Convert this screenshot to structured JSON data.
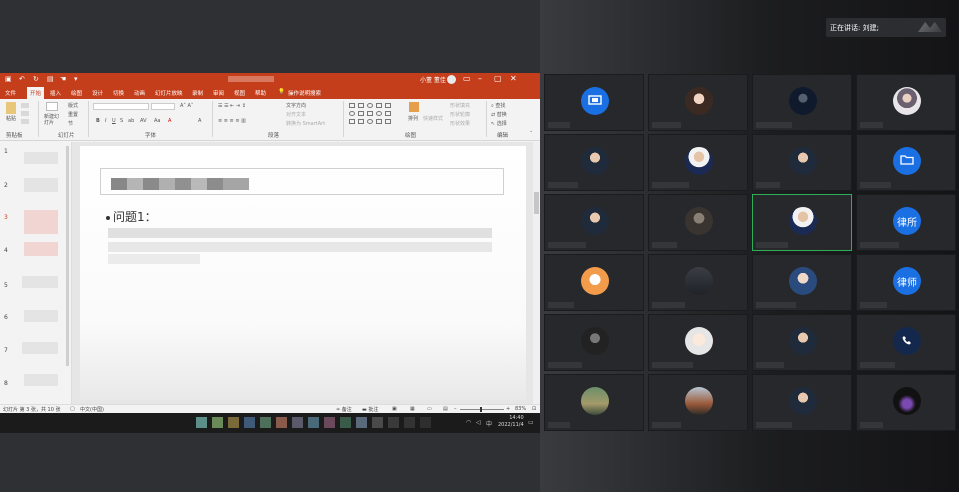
{
  "ppt": {
    "tabs": [
      "文件",
      "开始",
      "插入",
      "绘图",
      "设计",
      "切换",
      "动画",
      "幻灯片放映",
      "录制",
      "审阅",
      "视图",
      "帮助"
    ],
    "active_tab_index": 1,
    "tell_me": "操作说明搜索",
    "user": "小董 董佳",
    "groups": [
      "剪贴板",
      "幻灯片",
      "字体",
      "段落",
      "绘图",
      "编辑"
    ],
    "clipboard": {
      "paste": "粘贴"
    },
    "slides_group": {
      "new_slide": "新建幻灯片",
      "layout": "版式",
      "reset": "重置",
      "section": "节"
    },
    "paragraph_items": [
      "文字方向",
      "对齐文本",
      "转换为 SmartArt"
    ],
    "drawing_items": [
      "排列",
      "快速样式",
      "形状填充",
      "形状轮廓",
      "形状效果"
    ],
    "editing_items": [
      "查找",
      "替换",
      "选择"
    ],
    "thumb_numbers": [
      "1",
      "2",
      "3",
      "4",
      "5",
      "6",
      "7",
      "8"
    ],
    "selected_thumb": "3",
    "slide_bullet": "问题1：",
    "status": {
      "slide": "幻灯片 第 3 张，共 10 张",
      "lang": "中文(中国)",
      "notes": "备注",
      "comments": "批注",
      "zoom": "83%"
    },
    "clock": {
      "time": "14:40",
      "date": "2022/11/4"
    }
  },
  "meeting": {
    "speaking_label": "正在讲话: 刘建;",
    "tiles": [
      {
        "avatar": "p-blue",
        "icon": "screen-share-icon"
      },
      {
        "avatar": "p-girl"
      },
      {
        "avatar": "p-dark"
      },
      {
        "avatar": "p-lady"
      },
      {
        "avatar": "p-person"
      },
      {
        "avatar": "p-person2"
      },
      {
        "avatar": "p-person"
      },
      {
        "avatar": "p-blue",
        "icon": "folder-icon"
      },
      {
        "avatar": "p-person"
      },
      {
        "avatar": "p-gray"
      },
      {
        "avatar": "p-person2",
        "active": true
      },
      {
        "avatar": "p-blue",
        "text": "律所"
      },
      {
        "avatar": "p-orange"
      },
      {
        "avatar": "p-crowd"
      },
      {
        "avatar": "p-anime"
      },
      {
        "avatar": "p-blue",
        "text": "律师"
      },
      {
        "avatar": "p-bw"
      },
      {
        "avatar": "p-cartoon"
      },
      {
        "avatar": "p-person"
      },
      {
        "avatar": "p-navy",
        "icon": "phone-icon"
      },
      {
        "avatar": "p-land"
      },
      {
        "avatar": "p-tea"
      },
      {
        "avatar": "p-person"
      },
      {
        "avatar": "p-fire"
      }
    ]
  },
  "colors": {
    "ppt_accent": "#c43e1c",
    "active_speaker": "#2fae59",
    "avatar_blue": "#1a6fe3"
  }
}
